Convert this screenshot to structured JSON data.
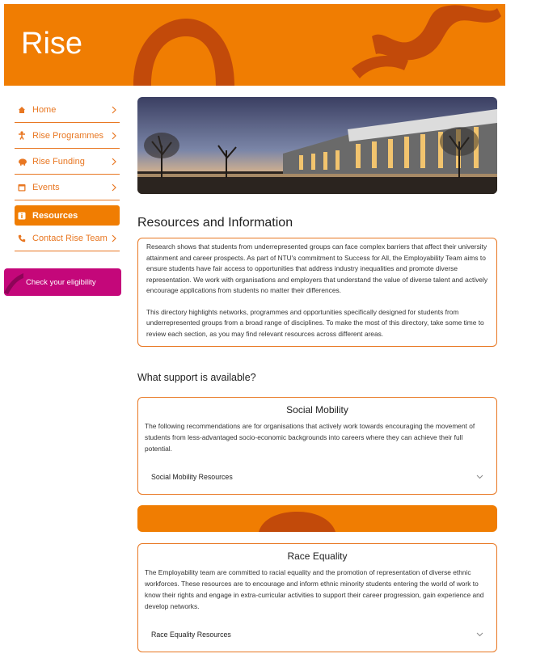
{
  "banner": {
    "brand": "Rise",
    "accent_color": "#f07d02"
  },
  "sidebar": {
    "items": [
      {
        "label": "Home",
        "icon": "home-icon"
      },
      {
        "label": "Rise Programmes",
        "icon": "person-icon"
      },
      {
        "label": "Rise Funding",
        "icon": "piggy-bank-icon"
      },
      {
        "label": "Events",
        "icon": "calendar-icon"
      },
      {
        "label": "Resources",
        "icon": "info-icon",
        "active": true
      },
      {
        "label": "Contact Rise Team",
        "icon": "phone-icon"
      }
    ],
    "cta": {
      "label": "Check your eligibility",
      "color": "#c4077a"
    }
  },
  "main": {
    "title": "Resources and Information",
    "intro": [
      "Research shows that students from underrepresented groups can face complex barriers that affect their university attainment and career prospects. As part of NTU's commitment to Success for All, the Employability Team aims to ensure students have fair access to opportunities that address industry inequalities and promote diverse representation. We work with organisations and employers that understand the value of diverse talent and actively encourage applications from students no matter their differences.",
      "This directory highlights networks, programmes and opportunities specifically designed for students from underrepresented groups from a broad range of disciplines. To make the most of this directory, take some time to review each section, as you may find relevant resources across different areas."
    ],
    "support_heading": "What support is available?",
    "sections": [
      {
        "title": "Social Mobility",
        "body": "The following recommendations are for organisations that actively work towards encouraging the movement of students from less-advantaged socio-economic backgrounds into careers where they can achieve their full potential.",
        "accordion": "Social Mobility Resources"
      },
      {
        "title": "Race Equality",
        "body": "The Employability team are committed to racial equality and the promotion of representation of diverse ethnic workforces. These resources are to encourage and inform ethnic minority students entering the world of work to know their rights and engage in extra-curricular activities to support their career progression, gain experience and develop networks.",
        "accordion": "Race Equality Resources"
      }
    ]
  }
}
